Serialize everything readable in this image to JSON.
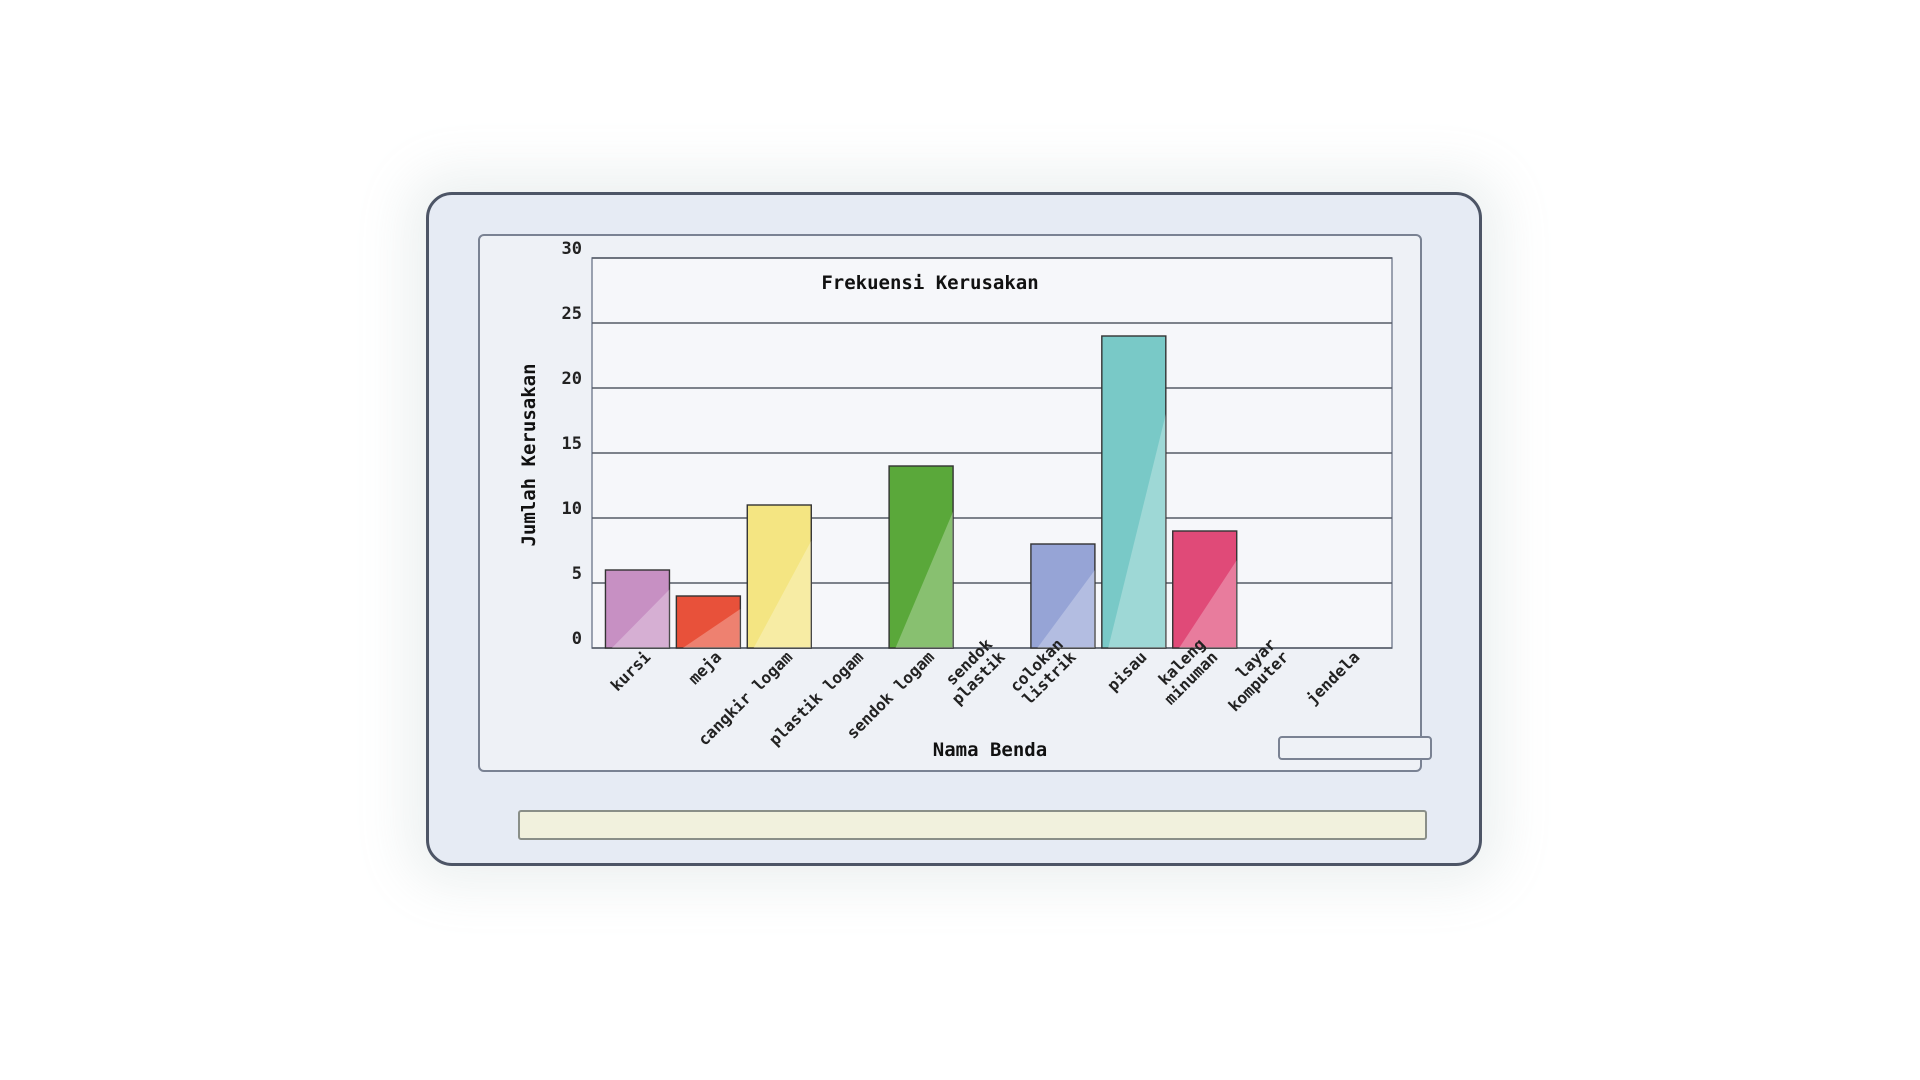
{
  "chart_data": {
    "type": "bar",
    "title": "Frekuensi Kerusakan",
    "xlabel": "Nama Benda",
    "ylabel": "Jumlah Kerusakan",
    "ylim": [
      0,
      30
    ],
    "yticks": [
      0,
      5,
      10,
      15,
      20,
      25,
      30
    ],
    "grid": true,
    "legend": "none",
    "categories": [
      "kursi",
      "meja",
      "cangkir logam",
      "plastik logam",
      "sendok logam",
      "sendok plastik",
      "colokan listrik",
      "pisau",
      "kaleng minuman",
      "layar komputer",
      "jendela"
    ],
    "category_lines": [
      [
        "kursi"
      ],
      [
        "meja"
      ],
      [
        "cangkir logam"
      ],
      [
        "plastik logam"
      ],
      [
        "sendok logam"
      ],
      [
        "sendok",
        "plastik"
      ],
      [
        "colokan",
        "listrik"
      ],
      [
        "pisau"
      ],
      [
        "kaleng",
        "minuman"
      ],
      [
        "layar",
        "komputer"
      ],
      [
        "jendela"
      ]
    ],
    "values": [
      6,
      4,
      11,
      0,
      14,
      0,
      8,
      24,
      9,
      0,
      0
    ],
    "bar_colors": [
      "#c790c3",
      "#e8513a",
      "#f4e582",
      null,
      "#5aa83a",
      null,
      "#96a4d6",
      "#79c9c7",
      "#e04a78",
      null,
      null
    ]
  }
}
